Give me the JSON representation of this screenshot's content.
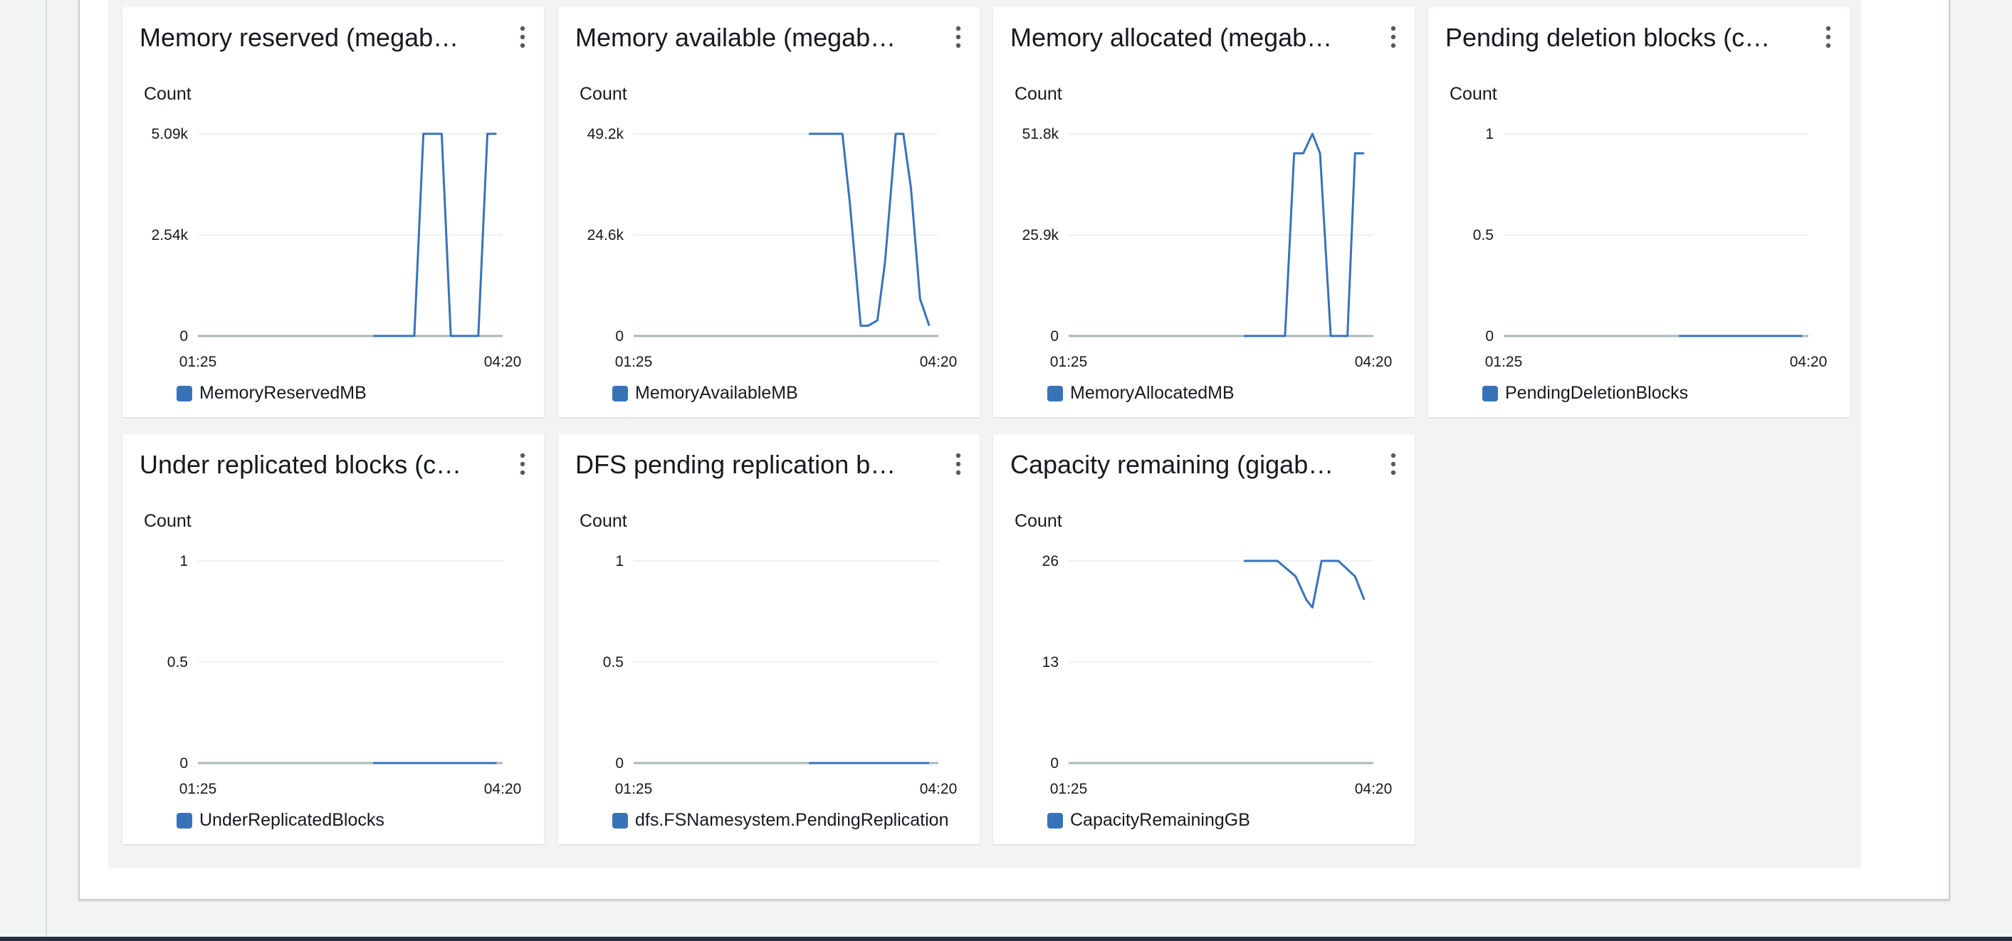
{
  "colors": {
    "series": "#3873b9",
    "grid": "#e9ebed",
    "baseline": "#aab7b8"
  },
  "widgets": [
    {
      "title": "Memory reserved (megab…",
      "axis_label": "Count",
      "yticks": [
        "5.09k",
        "2.54k",
        "0"
      ],
      "xticks": [
        "01:25",
        "04:20"
      ],
      "legend": "MemoryReservedMB",
      "menu_icon": "more-vertical-icon"
    },
    {
      "title": "Memory available (megab…",
      "axis_label": "Count",
      "yticks": [
        "49.2k",
        "24.6k",
        "0"
      ],
      "xticks": [
        "01:25",
        "04:20"
      ],
      "legend": "MemoryAvailableMB",
      "menu_icon": "more-vertical-icon"
    },
    {
      "title": "Memory allocated (megab…",
      "axis_label": "Count",
      "yticks": [
        "51.8k",
        "25.9k",
        "0"
      ],
      "xticks": [
        "01:25",
        "04:20"
      ],
      "legend": "MemoryAllocatedMB",
      "menu_icon": "more-vertical-icon"
    },
    {
      "title": "Pending deletion blocks (c…",
      "axis_label": "Count",
      "yticks": [
        "1",
        "0.5",
        "0"
      ],
      "xticks": [
        "01:25",
        "04:20"
      ],
      "legend": "PendingDeletionBlocks",
      "menu_icon": "more-vertical-icon"
    },
    {
      "title": "Under replicated blocks (c…",
      "axis_label": "Count",
      "yticks": [
        "1",
        "0.5",
        "0"
      ],
      "xticks": [
        "01:25",
        "04:20"
      ],
      "legend": "UnderReplicatedBlocks",
      "menu_icon": "more-vertical-icon"
    },
    {
      "title": "DFS pending replication b…",
      "axis_label": "Count",
      "yticks": [
        "1",
        "0.5",
        "0"
      ],
      "xticks": [
        "01:25",
        "04:20"
      ],
      "legend": "dfs.FSNamesystem.PendingReplication",
      "menu_icon": "more-vertical-icon"
    },
    {
      "title": "Capacity remaining (gigab…",
      "axis_label": "Count",
      "yticks": [
        "26",
        "13",
        "0"
      ],
      "xticks": [
        "01:25",
        "04:20"
      ],
      "legend": "CapacityRemainingGB",
      "menu_icon": "more-vertical-icon"
    }
  ],
  "chart_data": [
    {
      "type": "line",
      "title": "Memory reserved (megab…",
      "ylabel": "Count",
      "x_range": [
        "01:25",
        "04:20"
      ],
      "ylim": [
        0,
        5090
      ],
      "series": [
        {
          "name": "MemoryReservedMB",
          "points": [
            [
              0.575,
              0
            ],
            [
              0.71,
              0
            ],
            [
              0.74,
              5090
            ],
            [
              0.8,
              5090
            ],
            [
              0.83,
              0
            ],
            [
              0.92,
              0
            ],
            [
              0.95,
              5090
            ],
            [
              0.98,
              5090
            ]
          ]
        }
      ]
    },
    {
      "type": "line",
      "title": "Memory available (megab…",
      "ylabel": "Count",
      "x_range": [
        "01:25",
        "04:20"
      ],
      "ylim": [
        0,
        49200
      ],
      "series": [
        {
          "name": "MemoryAvailableMB",
          "points": [
            [
              0.575,
              49200
            ],
            [
              0.685,
              49200
            ],
            [
              0.71,
              32000
            ],
            [
              0.745,
              2500
            ],
            [
              0.77,
              2500
            ],
            [
              0.8,
              3800
            ],
            [
              0.825,
              18000
            ],
            [
              0.86,
              49200
            ],
            [
              0.885,
              49200
            ],
            [
              0.91,
              36000
            ],
            [
              0.94,
              9000
            ],
            [
              0.97,
              2500
            ]
          ]
        }
      ]
    },
    {
      "type": "line",
      "title": "Memory allocated (megab…",
      "ylabel": "Count",
      "x_range": [
        "01:25",
        "04:20"
      ],
      "ylim": [
        0,
        51800
      ],
      "series": [
        {
          "name": "MemoryAllocatedMB",
          "points": [
            [
              0.575,
              0
            ],
            [
              0.71,
              0
            ],
            [
              0.74,
              46800
            ],
            [
              0.77,
              46800
            ],
            [
              0.8,
              51800
            ],
            [
              0.825,
              46800
            ],
            [
              0.86,
              0
            ],
            [
              0.915,
              0
            ],
            [
              0.94,
              46800
            ],
            [
              0.97,
              46800
            ]
          ]
        }
      ]
    },
    {
      "type": "line",
      "title": "Pending deletion blocks (c…",
      "ylabel": "Count",
      "x_range": [
        "01:25",
        "04:20"
      ],
      "ylim": [
        0,
        1
      ],
      "series": [
        {
          "name": "PendingDeletionBlocks",
          "points": [
            [
              0.575,
              0
            ],
            [
              0.98,
              0
            ]
          ]
        }
      ]
    },
    {
      "type": "line",
      "title": "Under replicated blocks (c…",
      "ylabel": "Count",
      "x_range": [
        "01:25",
        "04:20"
      ],
      "ylim": [
        0,
        1
      ],
      "series": [
        {
          "name": "UnderReplicatedBlocks",
          "points": [
            [
              0.575,
              0
            ],
            [
              0.98,
              0
            ]
          ]
        }
      ]
    },
    {
      "type": "line",
      "title": "DFS pending replication b…",
      "ylabel": "Count",
      "x_range": [
        "01:25",
        "04:20"
      ],
      "ylim": [
        0,
        1
      ],
      "series": [
        {
          "name": "dfs.FSNamesystem.PendingReplication",
          "points": [
            [
              0.575,
              0
            ],
            [
              0.97,
              0
            ]
          ]
        }
      ]
    },
    {
      "type": "line",
      "title": "Capacity remaining (gigab…",
      "ylabel": "Count",
      "x_range": [
        "01:25",
        "04:20"
      ],
      "ylim": [
        0,
        26
      ],
      "series": [
        {
          "name": "CapacityRemainingGB",
          "points": [
            [
              0.575,
              26
            ],
            [
              0.685,
              26
            ],
            [
              0.745,
              24
            ],
            [
              0.78,
              21
            ],
            [
              0.8,
              20
            ],
            [
              0.83,
              26
            ],
            [
              0.885,
              26
            ],
            [
              0.94,
              24
            ],
            [
              0.97,
              21
            ]
          ]
        }
      ]
    }
  ]
}
